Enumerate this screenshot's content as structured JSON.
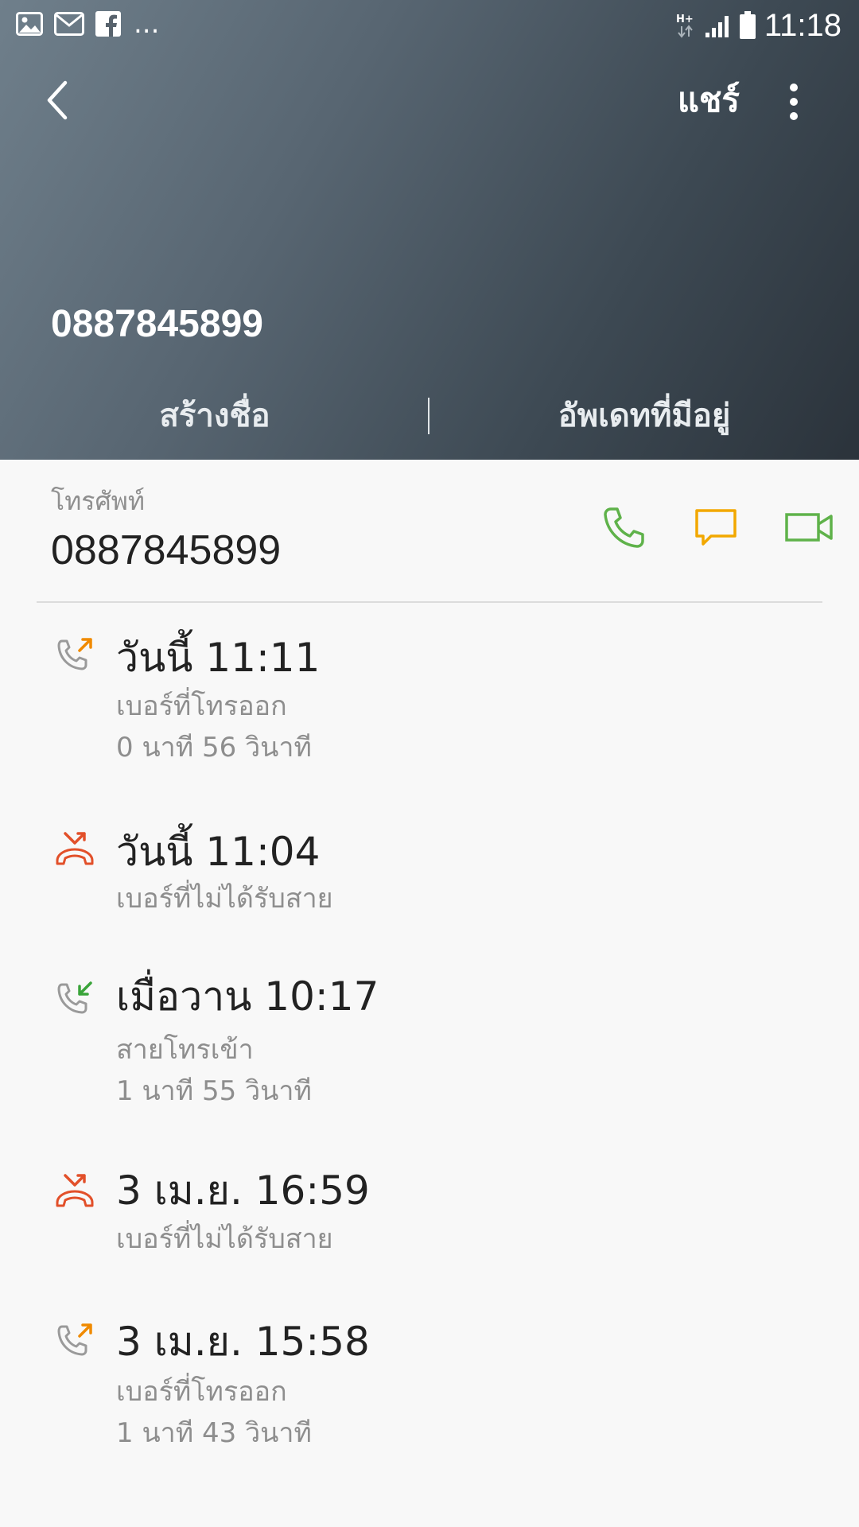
{
  "status_bar": {
    "time": "11:18",
    "more": "...",
    "left_icons": [
      "gallery-icon",
      "mail-icon",
      "facebook-icon"
    ],
    "right_icons": [
      "network-hplus-icon",
      "signal-icon",
      "battery-icon"
    ]
  },
  "header": {
    "share_label": "แชร์",
    "contact_number": "0887845899",
    "create_contact_label": "สร้างชื่อ",
    "update_existing_label": "อัพเดทที่มีอยู่"
  },
  "phone": {
    "label": "โทรศัพท์",
    "number": "0887845899"
  },
  "colors": {
    "call_green": "#5fb24a",
    "message_yellow": "#f2a800",
    "video_green": "#5fb24a",
    "missed_red": "#e2502a",
    "outgoing_arrow": "#f08a00",
    "incoming_arrow": "#3aa43a"
  },
  "call_log": [
    {
      "type": "outgoing",
      "icon": "outgoing-call-icon",
      "title": "วันนี้ 11:11",
      "status": "เบอร์ที่โทรออก",
      "duration": "0 นาที 56 วินาที"
    },
    {
      "type": "missed",
      "icon": "missed-call-icon",
      "title": "วันนี้ 11:04",
      "status": "เบอร์ที่ไม่ได้รับสาย",
      "duration": ""
    },
    {
      "type": "incoming",
      "icon": "incoming-call-icon",
      "title": "เมื่อวาน 10:17",
      "status": "สายโทรเข้า",
      "duration": "1 นาที 55 วินาที"
    },
    {
      "type": "missed",
      "icon": "missed-call-icon",
      "title": "3 เม.ย. 16:59",
      "status": "เบอร์ที่ไม่ได้รับสาย",
      "duration": ""
    },
    {
      "type": "outgoing",
      "icon": "outgoing-call-icon",
      "title": "3 เม.ย. 15:58",
      "status": "เบอร์ที่โทรออก",
      "duration": "1 นาที 43 วินาที"
    }
  ]
}
